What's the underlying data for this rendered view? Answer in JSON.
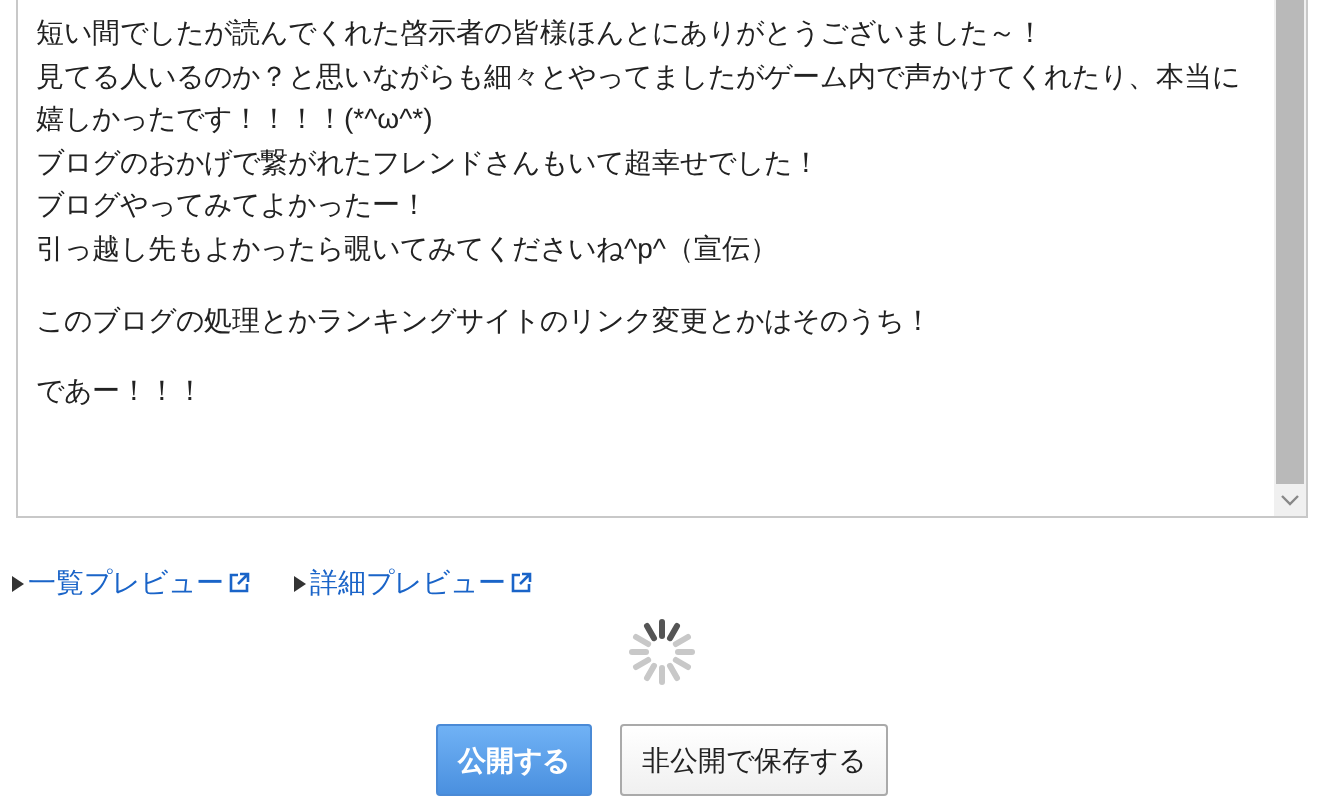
{
  "editor": {
    "paragraphs": [
      [
        "短い間でしたが読んでくれた啓示者の皆様ほんとにありがとうございました～！",
        "見てる人いるのか？と思いながらも細々とやってましたがゲーム内で声かけてくれたり、本当に",
        "嬉しかったです！！！！(*^ω^*)",
        "ブログのおかげで繋がれたフレンドさんもいて超幸せでした！",
        "ブログやってみてよかったー！",
        "引っ越し先もよかったら覗いてみてくださいね^p^（宣伝）"
      ],
      [
        "このブログの処理とかランキングサイトのリンク変更とかはそのうち！"
      ],
      [
        "であー！！！"
      ]
    ]
  },
  "preview_links": [
    "一覧プレビュー",
    "詳細プレビュー"
  ],
  "buttons": [
    {
      "label": "公開する",
      "kind": "primary"
    },
    {
      "label": "非公開で保存する",
      "kind": "secondary"
    }
  ]
}
